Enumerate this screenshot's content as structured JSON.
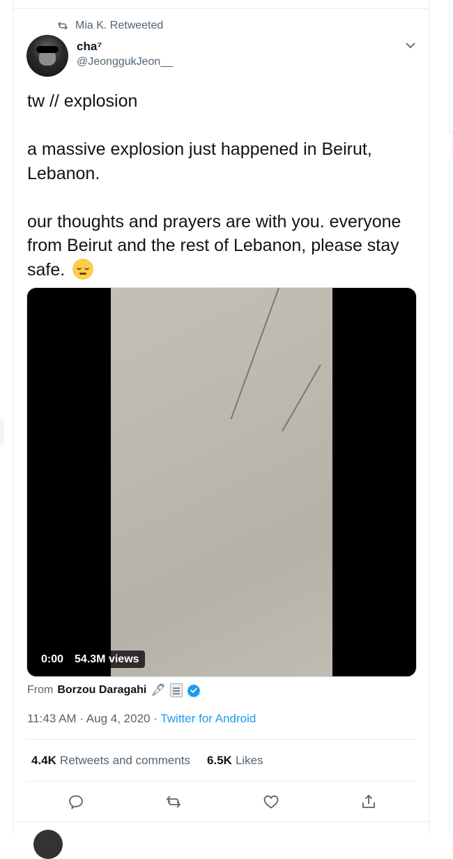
{
  "retweet_context": {
    "text": "Mia K. Retweeted",
    "icon": "retweet-icon"
  },
  "author": {
    "name": "cha⁷",
    "handle": "@JeonggukJeon__"
  },
  "tweet": {
    "text": "tw // explosion\n\na massive explosion just happened in Beirut, Lebanon.\n\nour thoughts and prayers are with you. everyone from Beirut and the rest of Lebanon, please stay safe.",
    "emoji": "pensive-face"
  },
  "video": {
    "time": "0:00",
    "views": "54.3M views"
  },
  "attribution": {
    "prefix": "From",
    "source_name": "Borzou Daragahi",
    "icons": [
      "pen-icon",
      "notepad-icon",
      "verified-icon"
    ]
  },
  "meta": {
    "time": "11:43 AM",
    "separator": "·",
    "date": "Aug 4, 2020",
    "client": "Twitter for Android"
  },
  "stats": {
    "retweets_count": "4.4K",
    "retweets_label": "Retweets and comments",
    "likes_count": "6.5K",
    "likes_label": "Likes"
  },
  "actions": [
    "reply-icon",
    "retweet-icon",
    "like-icon",
    "share-icon"
  ],
  "colors": {
    "link": "#1d9bf0",
    "secondary_text": "#536471",
    "border": "#e6ecf0"
  }
}
